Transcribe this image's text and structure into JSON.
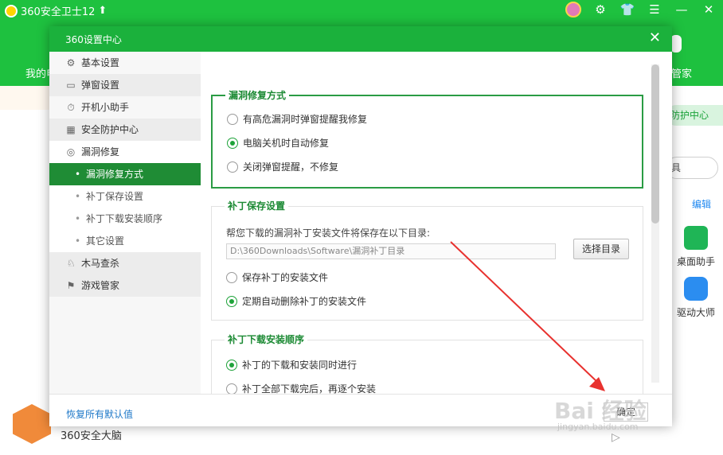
{
  "app": {
    "title": "360安全卫士12",
    "up_arrow": "⬆",
    "left_nav_label": "我的电",
    "right_nav_label": "管家",
    "protect_center": "防护中心",
    "search_text": "具",
    "edit_link": "编辑",
    "tools": [
      {
        "label": "桌面助手",
        "icon": "desktop-assistant-icon"
      },
      {
        "label": "驱动大师",
        "icon": "driver-master-icon"
      }
    ],
    "brain_label": "360安全大脑"
  },
  "dialog": {
    "title": "360设置中心",
    "close_glyph": "✕",
    "sidebar": {
      "top_items": [
        {
          "label": "基本设置",
          "icon": "gear-icon"
        },
        {
          "label": "弹窗设置",
          "icon": "window-icon"
        },
        {
          "label": "开机小助手",
          "icon": "timer-icon"
        },
        {
          "label": "安全防护中心",
          "icon": "grid-icon"
        },
        {
          "label": "漏洞修复",
          "icon": "patch-icon"
        }
      ],
      "sub_items": [
        {
          "label": "漏洞修复方式",
          "active": true
        },
        {
          "label": "补丁保存设置",
          "active": false
        },
        {
          "label": "补丁下载安装顺序",
          "active": false
        },
        {
          "label": "其它设置",
          "active": false
        }
      ],
      "bottom_items": [
        {
          "label": "木马查杀",
          "icon": "horse-icon"
        },
        {
          "label": "游戏管家",
          "icon": "game-icon"
        }
      ]
    },
    "sections": {
      "method": {
        "title": "漏洞修复方式",
        "options": [
          {
            "label": "有高危漏洞时弹窗提醒我修复",
            "checked": false
          },
          {
            "label": "电脑关机时自动修复",
            "checked": true
          },
          {
            "label": "关闭弹窗提醒，不修复",
            "checked": false
          }
        ]
      },
      "save": {
        "title": "补丁保存设置",
        "description": "帮您下载的漏洞补丁安装文件将保存在以下目录:",
        "path": "D:\\360Downloads\\Software\\漏洞补丁目录",
        "choose_button": "选择目录",
        "options": [
          {
            "label": "保存补丁的安装文件",
            "checked": false
          },
          {
            "label": "定期自动删除补丁的安装文件",
            "checked": true
          }
        ]
      },
      "order": {
        "title": "补丁下载安装顺序",
        "options": [
          {
            "label": "补丁的下载和安装同时进行",
            "checked": true
          },
          {
            "label": "补丁全部下载完后，再逐个安装",
            "checked": false
          }
        ]
      }
    },
    "footer": {
      "restore_link": "恢复所有默认值",
      "confirm_button": "确定"
    }
  },
  "watermark": {
    "main": "Bai 经验",
    "sub": "jingyan.baidu.com"
  },
  "colors": {
    "brand_green": "#1ec13f",
    "dialog_header": "#1bb13c",
    "active_nav": "#1f8c35",
    "link_blue": "#1e78c8",
    "arrow_red": "#e8322f"
  }
}
